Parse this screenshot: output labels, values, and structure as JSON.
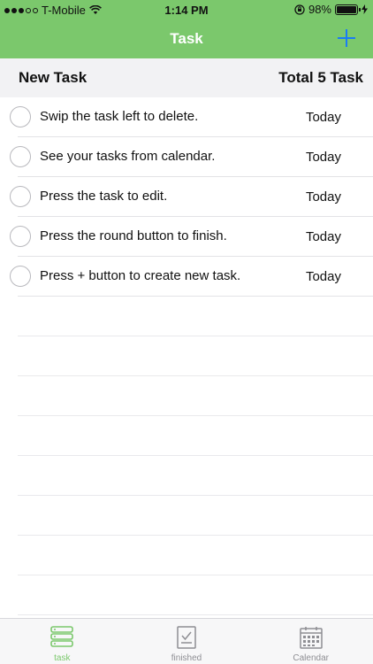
{
  "status_bar": {
    "carrier": "T-Mobile",
    "time": "1:14 PM",
    "battery_percent_label": "98%",
    "battery_level": 0.98
  },
  "nav": {
    "title": "Task",
    "add_icon": "plus-icon"
  },
  "header": {
    "left": "New Task",
    "right": "Total 5 Task"
  },
  "tasks": [
    {
      "text": "Swip the task left to delete.",
      "date": "Today"
    },
    {
      "text": "See your tasks from calendar.",
      "date": "Today"
    },
    {
      "text": "Press the task to edit.",
      "date": "Today"
    },
    {
      "text": "Press the round button to finish.",
      "date": "Today"
    },
    {
      "text": "Press + button to create new task.",
      "date": "Today"
    }
  ],
  "tabs": [
    {
      "label": "task",
      "icon": "task-list-icon",
      "active": true
    },
    {
      "label": "finished",
      "icon": "finished-check-icon",
      "active": false
    },
    {
      "label": "Calendar",
      "icon": "calendar-icon",
      "active": false
    }
  ],
  "colors": {
    "accent": "#7bc86c",
    "add_button": "#1a7cf5"
  }
}
